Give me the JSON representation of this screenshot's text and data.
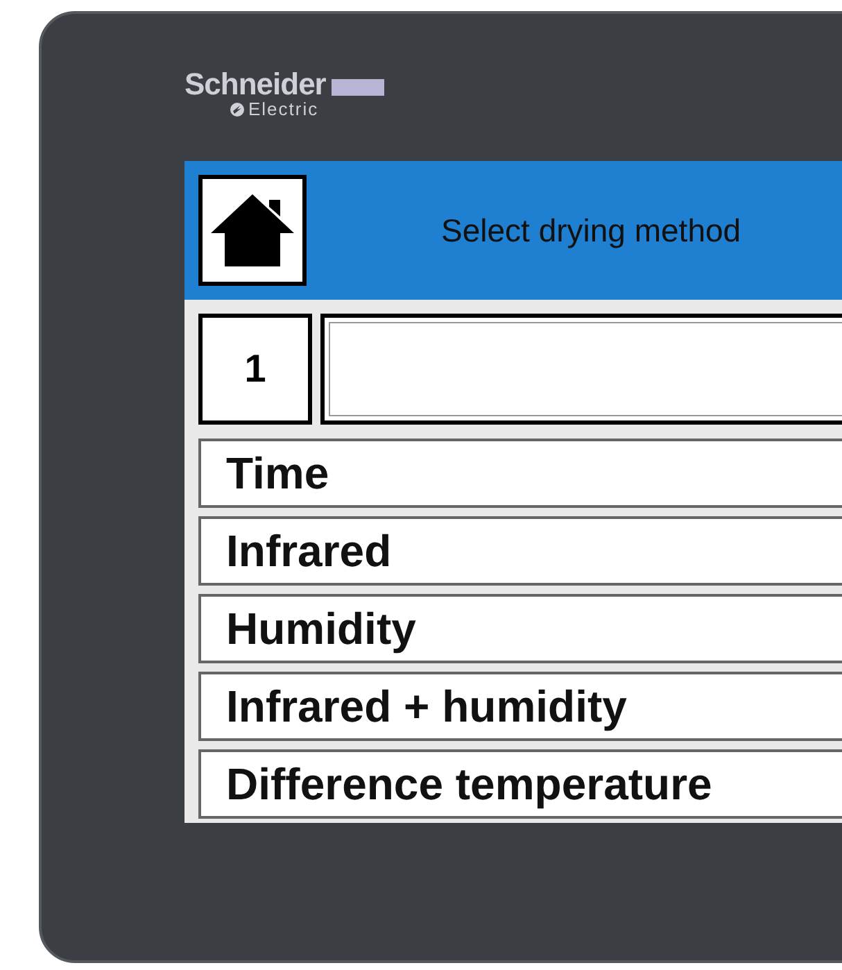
{
  "brand": {
    "name": "Schneider",
    "sub": "Electric"
  },
  "header": {
    "title": "Select drying method"
  },
  "selection": {
    "number": "1"
  },
  "methods": [
    {
      "label": "Time"
    },
    {
      "label": "Infrared"
    },
    {
      "label": "Humidity"
    },
    {
      "label": "Infrared + humidity"
    },
    {
      "label": "Difference temperature"
    }
  ]
}
